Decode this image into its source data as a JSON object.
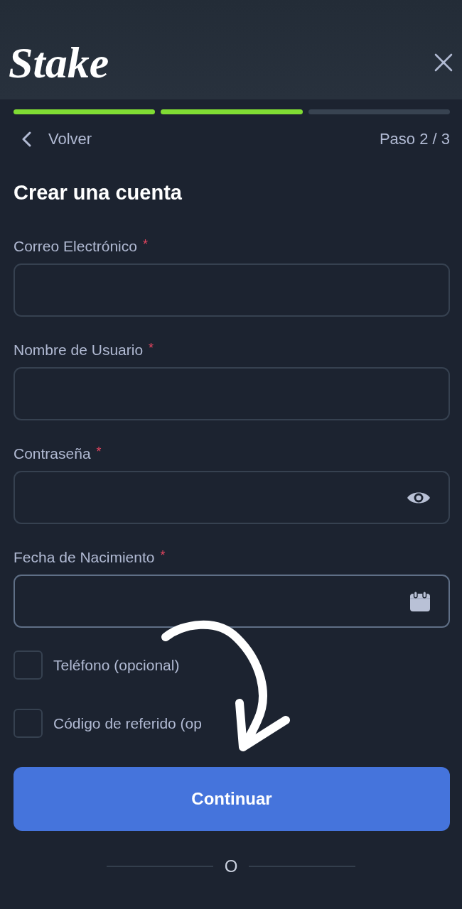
{
  "header": {
    "logo": "Stake"
  },
  "progress": {
    "segments": [
      {
        "complete": true
      },
      {
        "complete": true
      },
      {
        "complete": false
      }
    ]
  },
  "nav": {
    "back": "Volver",
    "step": "Paso 2 / 3"
  },
  "title": "Crear una cuenta",
  "fields": [
    {
      "kind": "email",
      "label": "Correo Electrónico",
      "marker": "*",
      "focused": false
    },
    {
      "kind": "username",
      "label": "Nombre de Usuario",
      "marker": "*",
      "focused": false
    },
    {
      "kind": "password",
      "label": "Contraseña",
      "marker": "*",
      "focused": false
    },
    {
      "kind": "date",
      "label": "Fecha de Nacimiento",
      "marker": "*",
      "focused": true
    }
  ],
  "options": [
    {
      "label": "Teléfono (opcional)",
      "checked": false
    },
    {
      "label": "Código de referido (op",
      "checked": false
    }
  ],
  "submit": "Continuar",
  "divider": "O"
}
